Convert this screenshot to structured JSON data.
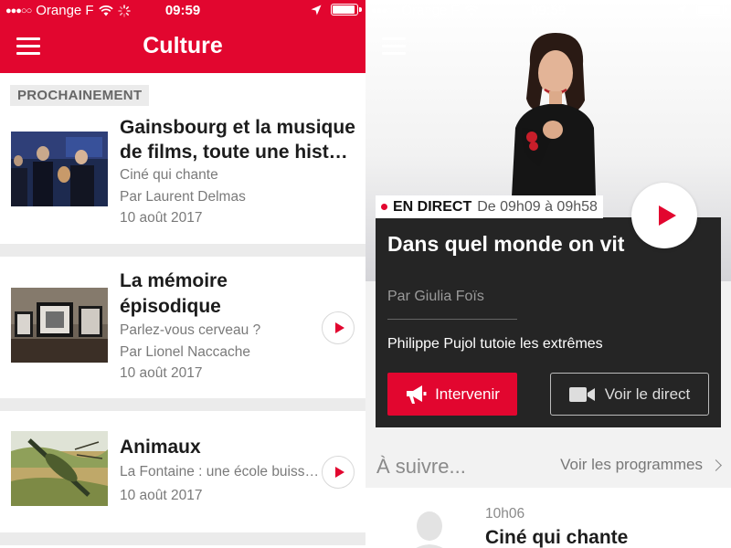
{
  "colors": {
    "accent": "#e2062f",
    "dark_panel": "#252525"
  },
  "status_bar": {
    "carrier": "Orange F",
    "time": "09:59"
  },
  "left_screen": {
    "header": {
      "title": "Culture"
    },
    "section_label": "PROCHAINEMENT",
    "items": [
      {
        "title_line1": "Gainsbourg et la musique",
        "title_line2": "de films, toute une hist…",
        "show": "Ciné qui chante",
        "author": "Par Laurent Delmas",
        "date": "10 août 2017",
        "has_play": false
      },
      {
        "title_line1": "La mémoire",
        "title_line2": "épisodique",
        "show": "Parlez-vous cerveau ?",
        "author": "Par Lionel Naccache",
        "date": "10 août 2017",
        "has_play": true
      },
      {
        "title_line1": "Animaux",
        "show": "La Fontaine : une école buiss…",
        "date": "10 août 2017",
        "has_play": true
      }
    ]
  },
  "right_screen": {
    "live": {
      "label": "EN DIRECT",
      "time_range": "De 09h09 à 09h58"
    },
    "player": {
      "show_title": "Dans quel monde on vit",
      "host": "Par Giulia Foïs",
      "episode": "Philippe Pujol tutoie les extrêmes",
      "intervenir_label": "Intervenir",
      "voir_direct_label": "Voir le direct"
    },
    "next": {
      "label": "À suivre...",
      "programs_link": "Voir les programmes",
      "item": {
        "time": "10h06",
        "title": "Ciné qui chante"
      }
    }
  },
  "icons": [
    "hamburger-icon",
    "signal-dots-icon",
    "wifi-icon",
    "activity-spinner-icon",
    "location-arrow-icon",
    "battery-icon",
    "play-icon",
    "megaphone-icon",
    "video-camera-icon",
    "chevron-right-icon",
    "person-silhouette-icon"
  ]
}
